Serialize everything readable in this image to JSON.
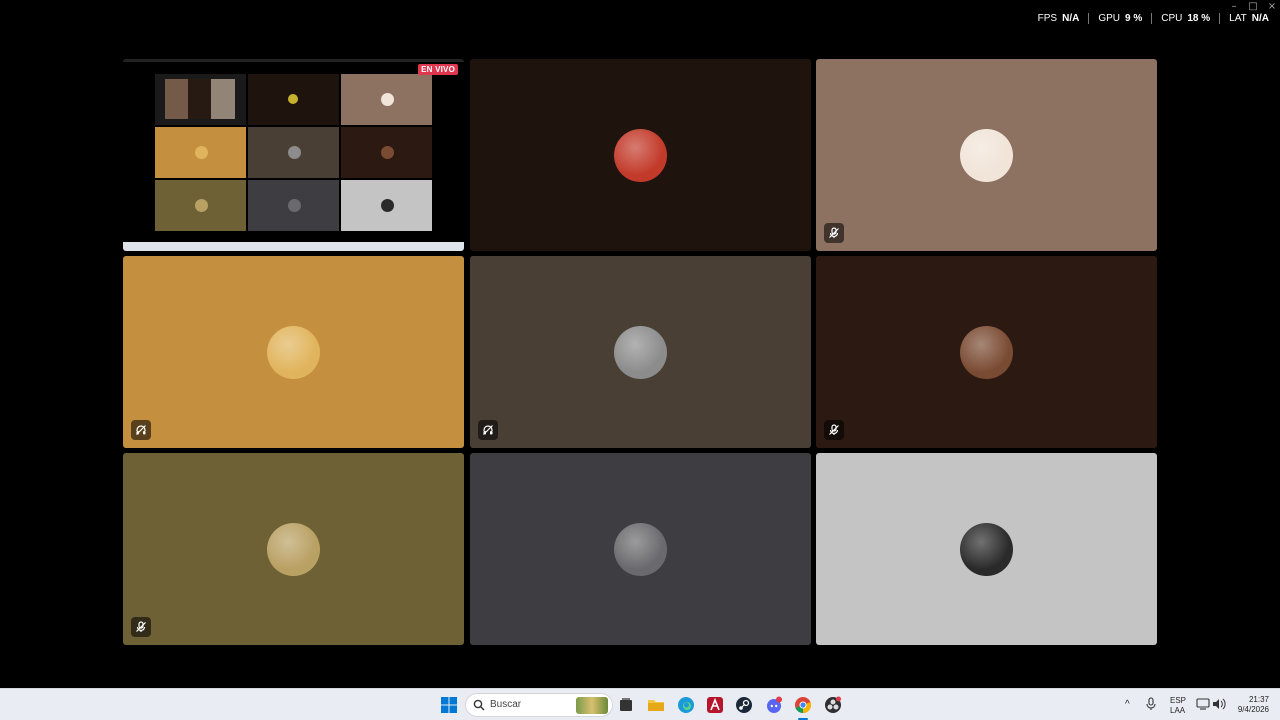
{
  "overlay_stats": [
    {
      "label": "FPS",
      "value": "N/A"
    },
    {
      "label": "GPU",
      "value": "9 %"
    },
    {
      "label": "CPU",
      "value": "18 %"
    },
    {
      "label": "LAT",
      "value": "N/A"
    }
  ],
  "window_controls": {
    "minimize": "–",
    "maximize": "□",
    "close": "×"
  },
  "stream": {
    "live_label": "EN VIVO"
  },
  "tiles": [
    {
      "bg": "#1f140d",
      "avatar_color": "#c23a2a",
      "muted": false
    },
    {
      "bg": "#8d7262",
      "avatar_color": "#f1e4d8",
      "muted": true
    },
    {
      "bg": "#c48f3e",
      "avatar_color": "#e0b45c",
      "muted": true
    },
    {
      "bg": "#4a3f34",
      "avatar_color": "#8c8c8c",
      "muted": true
    },
    {
      "bg": "#2c1a12",
      "avatar_color": "#7a4b33",
      "muted": true
    },
    {
      "bg": "#6d6135",
      "avatar_color": "#b9a063",
      "muted": true
    },
    {
      "bg": "#3e3e42",
      "avatar_color": "#6a6a6e",
      "muted": false
    },
    {
      "bg": "#c4c4c4",
      "avatar_color": "#2a2a2a",
      "muted": false
    }
  ],
  "taskbar": {
    "search_placeholder": "Buscar",
    "lang_top": "ESP",
    "lang_bottom": "LAA",
    "time": "21:37",
    "date": "9/4/2026"
  },
  "colors": {
    "accent": "#0078d4",
    "live": "#e0364f"
  }
}
